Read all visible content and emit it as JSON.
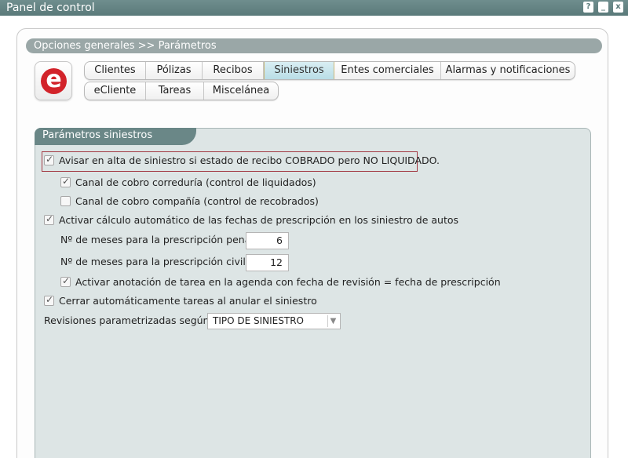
{
  "window": {
    "title": "Panel de control",
    "help_glyph": "?",
    "minimize_glyph": "_",
    "close_glyph": "x"
  },
  "breadcrumb": "Opciones generales >> Parámetros",
  "logo": {
    "letter": "e",
    "color": "#d2232a"
  },
  "tabs_row1": [
    "Clientes",
    "Pólizas",
    "Recibos",
    "Siniestros",
    "Entes comerciales",
    "Alarmas y notificaciones"
  ],
  "tabs_row2": [
    "eCliente",
    "Tareas",
    "Miscelánea"
  ],
  "active_tab": "Siniestros",
  "section_title": "Parámetros siniestros",
  "options": {
    "avisar": {
      "label": "Avisar en alta de siniestro si estado de recibo COBRADO pero NO LIQUIDADO.",
      "checked": true
    },
    "canal_correduria": {
      "label": "Canal de cobro correduría (control de liquidados)",
      "checked": true
    },
    "canal_compania": {
      "label": "Canal de cobro compañía (control de recobrados)",
      "checked": false
    },
    "activar_calculo": {
      "label": "Activar cálculo automático de las fechas de prescripción en los siniestro de autos",
      "checked": true
    },
    "meses_penal": {
      "label": "Nº de meses para la prescripción penal",
      "value": "6"
    },
    "meses_civil": {
      "label": "Nº de meses para la prescripción civil",
      "value": "12"
    },
    "activar_anotacion": {
      "label": "Activar anotación de tarea en la agenda con fecha de revisión = fecha de prescripción",
      "checked": true
    },
    "cerrar_tareas": {
      "label": "Cerrar automáticamente tareas al anular el siniestro",
      "checked": true
    },
    "revisiones": {
      "label": "Revisiones parametrizadas según",
      "selected": "TIPO DE SINIESTRO"
    }
  }
}
